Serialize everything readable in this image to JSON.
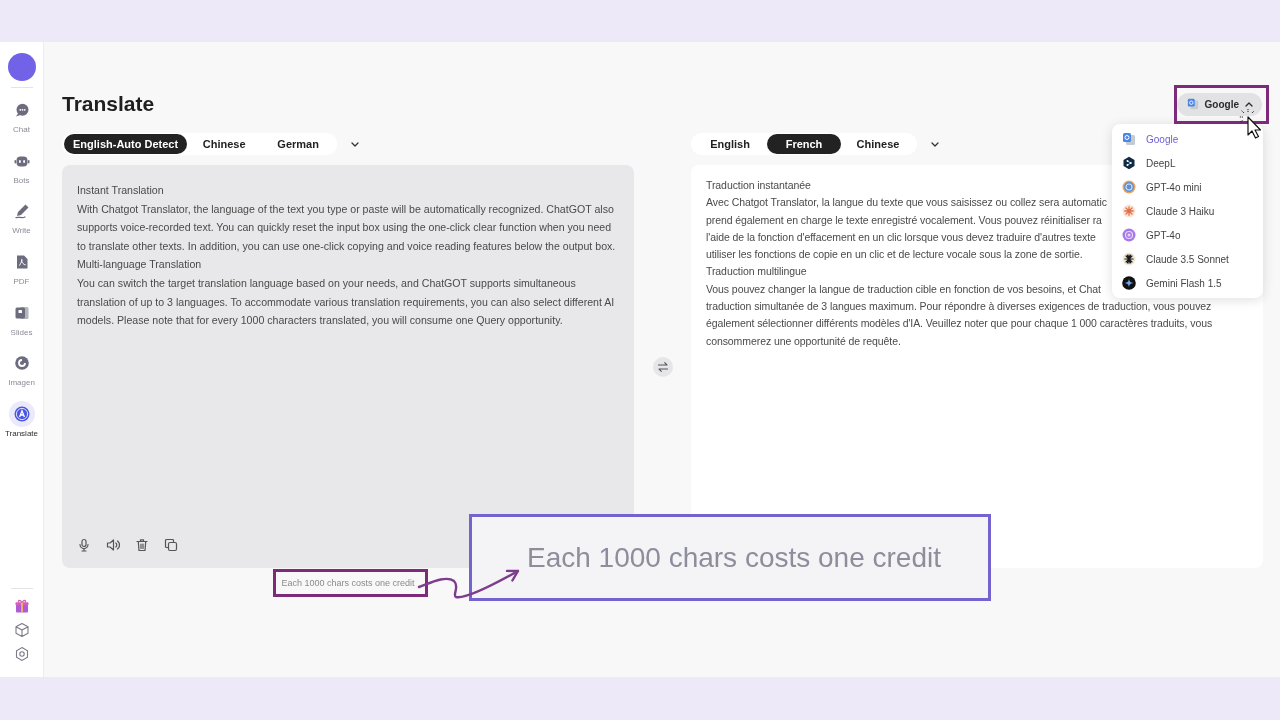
{
  "sidebar": {
    "items": [
      {
        "label": "Chat",
        "selected": false
      },
      {
        "label": "Bots",
        "selected": false
      },
      {
        "label": "Write",
        "selected": false
      },
      {
        "label": "PDF",
        "selected": false
      },
      {
        "label": "Slides",
        "selected": false
      },
      {
        "label": "Imagen",
        "selected": false
      },
      {
        "label": "Translate",
        "selected": true
      }
    ]
  },
  "header": {
    "title": "Translate",
    "engine_button": {
      "label": "Google",
      "expanded": true
    }
  },
  "source": {
    "languages": [
      {
        "label": "English-Auto Detect",
        "selected": true
      },
      {
        "label": "Chinese",
        "selected": false
      },
      {
        "label": "German",
        "selected": false
      }
    ],
    "paragraphs": [
      "Instant Translation",
      "With Chatgot Translator, the language of the text you type or paste will be automatically recognized. ChatGOT also supports voice-recorded text. You can quickly reset the input box using the one-click clear function when you need to translate other texts. In addition, you can use one-click copying and voice reading features below the output box.",
      "Multi-language Translation",
      "You can switch the target translation language based on your needs, and ChatGOT supports simultaneous translation of up to 3 languages. To accommodate various translation requirements, you can also select different AI models. Please note that for every 1000 characters translated, you will consume one Query opportunity."
    ],
    "note": "Each 1000 chars costs one credit"
  },
  "target": {
    "languages": [
      {
        "label": "English",
        "selected": false
      },
      {
        "label": "French",
        "selected": true
      },
      {
        "label": "Chinese",
        "selected": false
      }
    ],
    "lines": [
      "Traduction instantanée",
      "Avec Chatgot Translator, la langue du texte que vous saisissez ou collez sera automatic",
      "prend également en charge le texte enregistré vocalement. Vous pouvez réinitialiser ra",
      "l'aide de la fonction d'effacement en un clic lorsque vous devez traduire d'autres texte",
      "utiliser les fonctions de copie en un clic et de lecture vocale sous la zone de sortie.",
      "Traduction multilingue",
      "Vous pouvez changer la langue de traduction cible en fonction de vos besoins, et Chat",
      "traduction simultanée de 3 langues maximum. Pour répondre à diverses exigences de traduction, vous pouvez",
      "également sélectionner différents modèles d'IA. Veuillez noter que pour chaque 1 000 caractères traduits, vous",
      "consommerez une opportunité de requête."
    ]
  },
  "engine_menu": {
    "items": [
      {
        "label": "Google",
        "selected": true
      },
      {
        "label": "DeepL",
        "selected": false
      },
      {
        "label": "GPT-4o mini",
        "selected": false
      },
      {
        "label": "Claude 3 Haiku",
        "selected": false
      },
      {
        "label": "GPT-4o",
        "selected": false
      },
      {
        "label": "Claude 3.5 Sonnet",
        "selected": false
      },
      {
        "label": "Gemini Flash 1.5",
        "selected": false
      }
    ]
  },
  "annotation": {
    "callout": "Each 1000 chars costs one credit"
  }
}
